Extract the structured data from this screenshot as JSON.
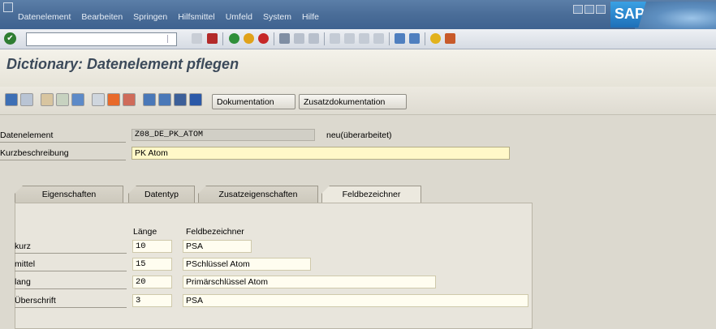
{
  "menu": {
    "items": [
      "Datenelement",
      "Bearbeiten",
      "Springen",
      "Hilfsmittel",
      "Umfeld",
      "System",
      "Hilfe"
    ]
  },
  "logo": {
    "text": "SAP"
  },
  "title": "Dictionary: Datenelement pflegen",
  "app_toolbar": {
    "dokumentation": "Dokumentation",
    "zusatzdokumentation": "Zusatzdokumentation"
  },
  "header": {
    "datenelement_label": "Datenelement",
    "datenelement_value": "Z08_DE_PK_ATOM",
    "status": "neu(überarbeitet)",
    "kurzbeschreibung_label": "Kurzbeschreibung",
    "kurzbeschreibung_value": "PK Atom"
  },
  "tabs": [
    {
      "label": "Eigenschaften",
      "active": false
    },
    {
      "label": "Datentyp",
      "active": false
    },
    {
      "label": "Zusatzeigenschaften",
      "active": false
    },
    {
      "label": "Feldbezeichner",
      "active": true
    }
  ],
  "field_labels": {
    "col_laenge": "Länge",
    "col_feldbezeichner": "Feldbezeichner",
    "rows": [
      {
        "name": "kurz",
        "length": "10",
        "text": "PSA"
      },
      {
        "name": "mittel",
        "length": "15",
        "text": "PSchlüssel Atom"
      },
      {
        "name": "lang",
        "length": "20",
        "text": "Primärschlüssel Atom"
      },
      {
        "name": "Überschrift",
        "length": "3",
        "text": "PSA"
      }
    ]
  }
}
